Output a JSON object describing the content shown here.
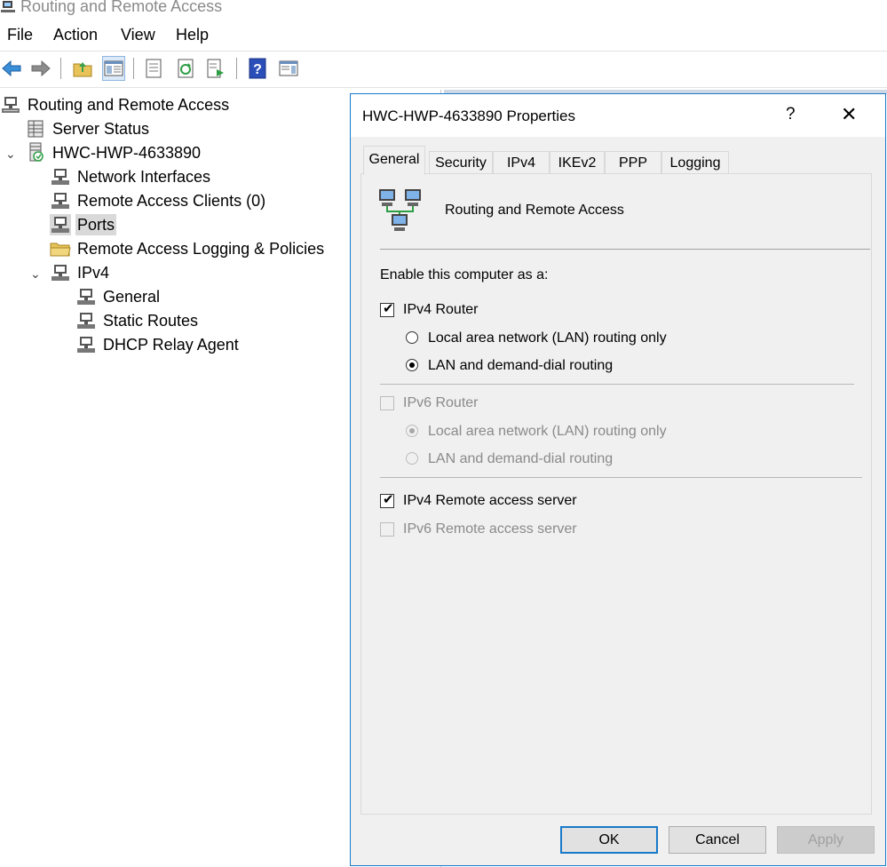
{
  "window": {
    "title": "Routing and Remote Access"
  },
  "menu": [
    "File",
    "Action",
    "View",
    "Help"
  ],
  "toolbar": [
    {
      "icon": "back-arrow-icon"
    },
    {
      "icon": "forward-arrow-icon"
    },
    {
      "icon": "up-folder-icon"
    },
    {
      "icon": "show-hide-tree-icon"
    },
    {
      "icon": "properties-icon"
    },
    {
      "icon": "refresh-icon"
    },
    {
      "icon": "export-list-icon"
    },
    {
      "icon": "help-icon"
    },
    {
      "icon": "show-action-pane-icon"
    }
  ],
  "tree": {
    "root": "Routing and Remote Access",
    "server_status": "Server Status",
    "server": "HWC-HWP-4633890",
    "network_interfaces": "Network Interfaces",
    "remote_access_clients": "Remote Access Clients (0)",
    "ports": "Ports",
    "logging_policies": "Remote Access Logging & Policies",
    "ipv4": "IPv4",
    "ipv4_general": "General",
    "static_routes": "Static Routes",
    "dhcp_relay": "DHCP Relay Agent",
    "selected": "Ports"
  },
  "dialog": {
    "title": "HWC-HWP-4633890 Properties",
    "help_glyph": "?",
    "close_glyph": "✕",
    "tabs": [
      "General",
      "Security",
      "IPv4",
      "IKEv2",
      "PPP",
      "Logging"
    ],
    "active_tab": "General",
    "header_text": "Routing and Remote Access",
    "enable_label": "Enable this computer as a:",
    "ipv4_router": {
      "label": "IPv4 Router",
      "checked": true
    },
    "ipv4_lan_only": {
      "label": "Local area network (LAN) routing only",
      "selected": false
    },
    "ipv4_lan_demand": {
      "label": "LAN and demand-dial routing",
      "selected": true
    },
    "ipv6_router": {
      "label": "IPv6 Router",
      "checked": false,
      "disabled": true
    },
    "ipv6_lan_only": {
      "label": "Local area network (LAN) routing only",
      "selected": true,
      "disabled": true
    },
    "ipv6_lan_demand": {
      "label": "LAN and demand-dial routing",
      "selected": false,
      "disabled": true
    },
    "ipv4_ras": {
      "label": "IPv4 Remote access server",
      "checked": true
    },
    "ipv6_ras": {
      "label": "IPv6 Remote access server",
      "checked": false,
      "disabled": true
    },
    "buttons": {
      "ok": "OK",
      "cancel": "Cancel",
      "apply": "Apply"
    },
    "accent_color": "#1979ca"
  }
}
